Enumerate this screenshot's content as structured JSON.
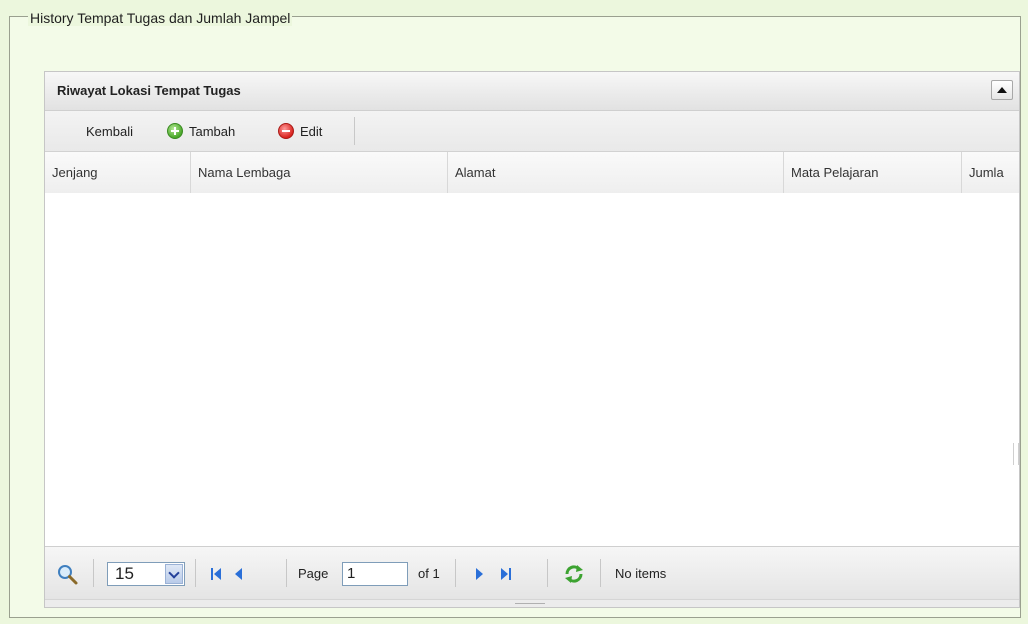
{
  "fieldset": {
    "legend": "History Tempat Tugas dan Jumlah Jampel"
  },
  "grid": {
    "title": "Riwayat Lokasi Tempat Tugas",
    "toolbar": {
      "back_label": "Kembali",
      "add_label": "Tambah",
      "edit_label": "Edit"
    },
    "columns": [
      "Jenjang",
      "Nama Lembaga",
      "Alamat",
      "Mata Pelajaran",
      "Jumla"
    ],
    "rows": []
  },
  "pager": {
    "page_size": "15",
    "page_label": "Page",
    "page_value": "1",
    "of_label": "of 1",
    "status": "No items"
  },
  "icons": {
    "search": "search-icon",
    "first": "first-page-icon",
    "prev": "prev-page-icon",
    "next": "next-page-icon",
    "last": "last-page-icon",
    "refresh": "refresh-icon",
    "add": "add-icon",
    "edit": "edit-icon",
    "collapse": "collapse-icon"
  },
  "colors": {
    "background": "#ecf7dd",
    "add": "#4aa72a",
    "edit": "#d9241f",
    "nav": "#2a6fd8",
    "refresh": "#3da331"
  }
}
